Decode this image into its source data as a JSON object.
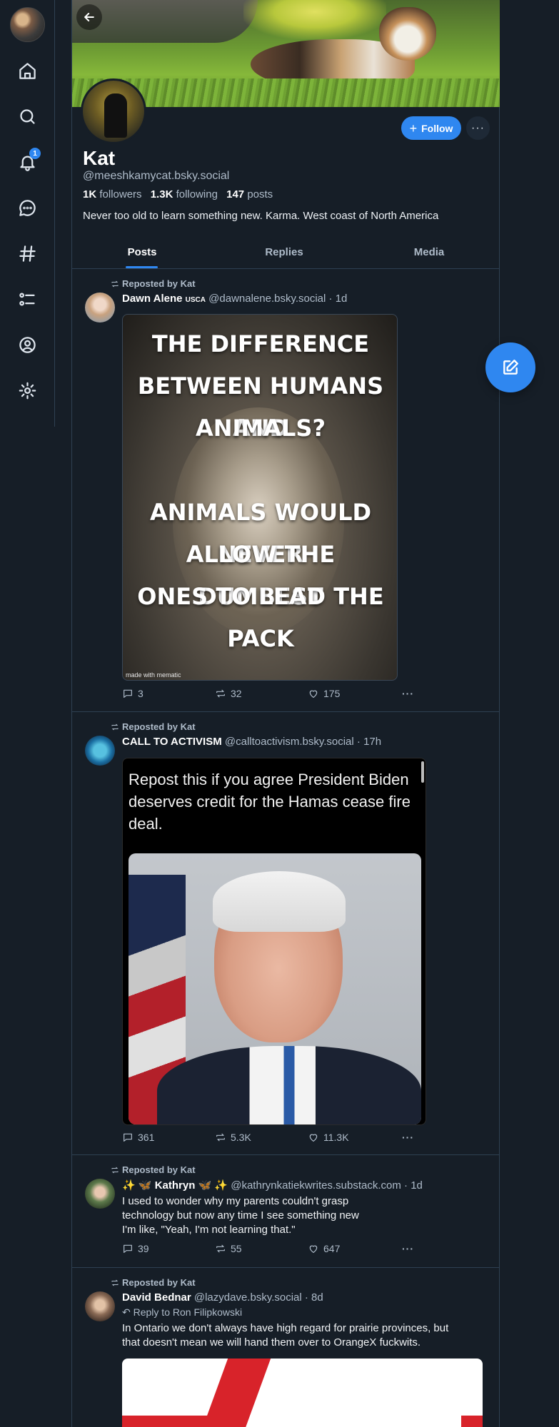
{
  "profile": {
    "display_name": "Kat",
    "handle": "@meeshkamycat.bsky.social",
    "followers_count": "1K",
    "followers_label": "followers",
    "following_count": "1.3K",
    "following_label": "following",
    "posts_count": "147",
    "posts_label": "posts",
    "bio": "Never too old to learn something new. Karma. West coast of North America",
    "follow_label": "Follow",
    "more_label": "···"
  },
  "nav": {
    "notification_badge": "1",
    "icons": [
      "home-icon",
      "search-icon",
      "bell-icon",
      "chat-icon",
      "hashtag-icon",
      "list-icon",
      "profile-icon",
      "gear-icon"
    ]
  },
  "tabs": [
    {
      "label": "Posts",
      "active": true
    },
    {
      "label": "Replies",
      "active": false
    },
    {
      "label": "Media",
      "active": false
    }
  ],
  "posts": [
    {
      "repost_label": "Reposted by Kat",
      "author_name": "Dawn Alene",
      "author_badge": "USCA",
      "author_handle": "@dawnalene.bsky.social",
      "time": "· 1d",
      "image_lines": [
        "THE DIFFERENCE",
        "BETWEEN HUMANS AND",
        "ANIMALS?",
        "",
        "ANIMALS WOULD NEVER",
        "ALLOW THE DUMBEST",
        "ONES TO LEAD THE",
        "PACK"
      ],
      "image_watermark": "made with mematic",
      "replies": "3",
      "reposts": "32",
      "likes": "175"
    },
    {
      "repost_label": "Reposted by Kat",
      "author_name": "CALL TO ACTIVISM",
      "author_handle": "@calltoactivism.bsky.social",
      "time": "· 17h",
      "image_text": "Repost this if you agree President Biden deserves credit for the Hamas cease fire deal.",
      "replies": "361",
      "reposts": "5.3K",
      "likes": "11.3K"
    },
    {
      "repost_label": "Reposted by Kat",
      "author_name": "✨ 🦋 Kathryn 🦋 ✨",
      "author_handle": "@kathrynkatiekwrites.substack.com",
      "time": "· 1d",
      "text_lines": [
        "I used to wonder why my parents couldn't grasp",
        "technology but now any time I see something new",
        "I'm like, \"Yeah, I'm not learning that.\""
      ],
      "replies": "39",
      "reposts": "55",
      "likes": "647"
    },
    {
      "repost_label": "Reposted by Kat",
      "author_name": "David Bednar",
      "author_handle": "@lazydave.bsky.social",
      "time": "· 8d",
      "reply_to": "Reply to Ron Filipkowski",
      "text_lines": [
        "In Ontario we don't always have high regard for prairie provinces, but",
        "that doesn't mean we will hand them over to OrangeX fuckwits."
      ]
    }
  ],
  "colors": {
    "background": "#161e27",
    "accent": "#2f87f0",
    "muted_text": "#aebbc9",
    "border": "#2e4052"
  }
}
